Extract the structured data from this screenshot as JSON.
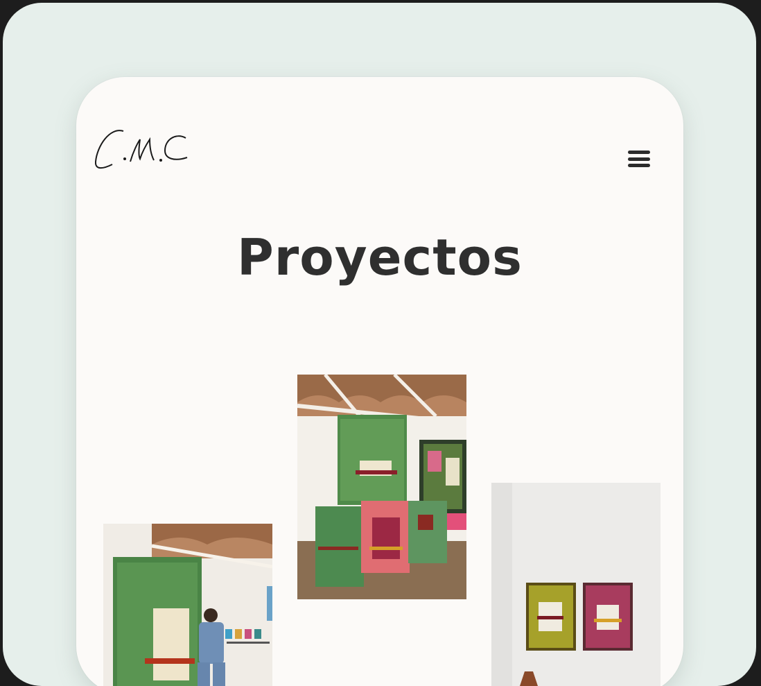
{
  "app": {
    "logo_text": "C.M.C",
    "page_title": "Proyectos"
  },
  "header": {
    "menu_icon": "hamburger-menu-icon"
  },
  "projects": [
    {
      "name": "gallery-installation-green-panels"
    },
    {
      "name": "artist-with-large-green-canvas"
    },
    {
      "name": "two-framed-paintings-on-wall"
    }
  ],
  "colors": {
    "outer_background": "#e6efeb",
    "page_background": "#fcfaf8",
    "title_color": "#2f2f2f"
  }
}
